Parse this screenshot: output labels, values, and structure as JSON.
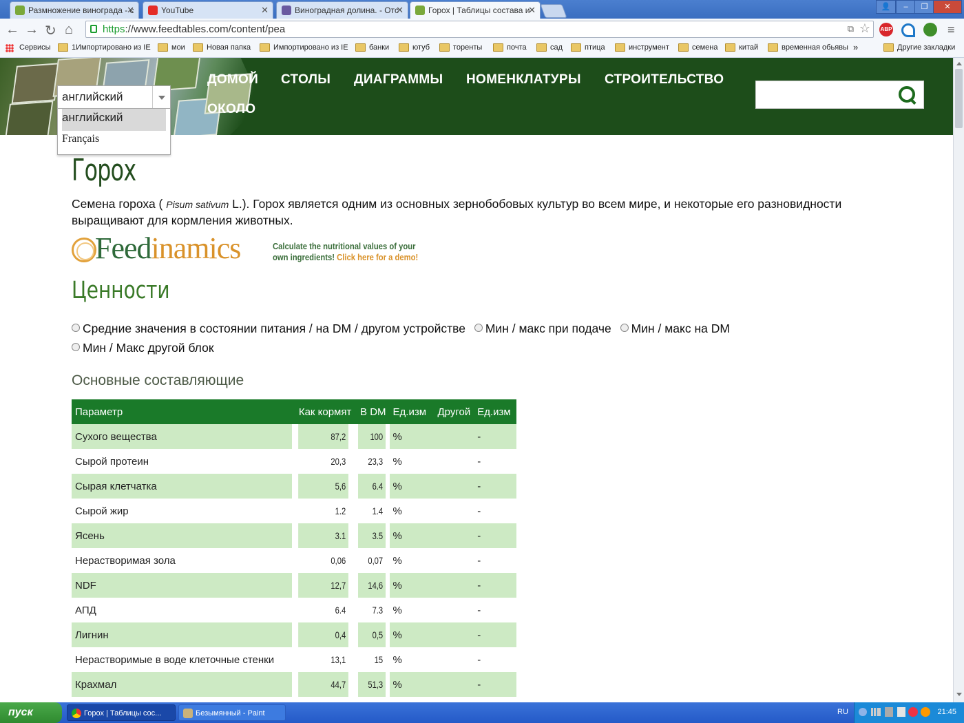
{
  "browser": {
    "tabs": [
      {
        "title": "Размножение винограда - с",
        "favicon_color": "#7aa83a",
        "active": false
      },
      {
        "title": "YouTube",
        "favicon_color": "#e52d27",
        "active": false
      },
      {
        "title": "Виноградная долина. - Отс",
        "favicon_color": "#6a5aa0",
        "active": false
      },
      {
        "title": "Горох | Таблицы состава и",
        "favicon_color": "#7aa83a",
        "active": true
      }
    ],
    "url_scheme": "https",
    "url_rest": "://www.feedtables.com/content/pea",
    "extensions": [
      "ABP"
    ],
    "bookmarks": [
      {
        "label": "Сервисы",
        "type": "apps"
      },
      {
        "label": "1Импортировано из IE",
        "type": "folder"
      },
      {
        "label": "мои",
        "type": "folder"
      },
      {
        "label": "Новая папка",
        "type": "folder"
      },
      {
        "label": "Импортировано из IE",
        "type": "folder"
      },
      {
        "label": "банки",
        "type": "folder"
      },
      {
        "label": "ютуб",
        "type": "folder"
      },
      {
        "label": "торенты",
        "type": "folder"
      },
      {
        "label": "почта",
        "type": "folder"
      },
      {
        "label": "сад",
        "type": "folder"
      },
      {
        "label": "птица",
        "type": "folder"
      },
      {
        "label": "инструмент",
        "type": "folder"
      },
      {
        "label": "семена",
        "type": "folder"
      },
      {
        "label": "китай",
        "type": "folder"
      },
      {
        "label": "временная обьявы",
        "type": "folder"
      }
    ],
    "more_bookmarks_glyph": "»",
    "other_bookmarks": "Другие закладки"
  },
  "site": {
    "nav": [
      "ДОМОЙ",
      "СТОЛЫ",
      "ДИАГРАММЫ",
      "НОМЕНКЛАТУРЫ",
      "СТРОИТЕЛЬСТВО",
      "ОКОЛО"
    ],
    "search_placeholder": "",
    "language": {
      "selected": "английский",
      "options": [
        "английский",
        "Français"
      ]
    }
  },
  "content": {
    "title": "Горох",
    "intro_before": "Семена гороха ( ",
    "intro_latin": "Pisum sativum",
    "intro_after": " L.). Горох является одним из основных зернобобовых культур во всем мире, и некоторые его разновидности выращивают для кормления животных.",
    "ad": {
      "logo_a": "Feed",
      "logo_b": "inamics",
      "line1": "Calculate the nutritional values of your",
      "line2_a": "own ingredients! ",
      "line2_b": "Click here for a demo!"
    },
    "values_heading": "Ценности",
    "radio_options": [
      "Средние значения в состоянии питания / на DM / другом устройстве",
      "Мин / макс при подаче",
      "Мин / макс на DM",
      "Мин / Макс другой блок"
    ],
    "table_heading": "Основные составляющие",
    "table": {
      "columns": [
        "Параметр",
        "Как кормят",
        "В DM",
        "Ед.изм",
        "Другой",
        "Ед.изм"
      ],
      "rows": [
        [
          "Сухого вещества",
          "87,2",
          "100",
          "%",
          "",
          "-"
        ],
        [
          "Сырой протеин",
          "20,3",
          "23,3",
          "%",
          "",
          "-"
        ],
        [
          "Сырая клетчатка",
          "5,6",
          "6.4",
          "%",
          "",
          "-"
        ],
        [
          "Сырой жир",
          "1.2",
          "1.4",
          "%",
          "",
          "-"
        ],
        [
          "Ясень",
          "3.1",
          "3.5",
          "%",
          "",
          "-"
        ],
        [
          "Нерастворимая зола",
          "0,06",
          "0,07",
          "%",
          "",
          "-"
        ],
        [
          "NDF",
          "12,7",
          "14,6",
          "%",
          "",
          "-"
        ],
        [
          "АПД",
          "6.4",
          "7.3",
          "%",
          "",
          "-"
        ],
        [
          "Лигнин",
          "0,4",
          "0,5",
          "%",
          "",
          "-"
        ],
        [
          "Нерастворимые в воде клеточные стенки",
          "13,1",
          "15",
          "%",
          "",
          "-"
        ],
        [
          "Крахмал",
          "44,7",
          "51,3",
          "%",
          "",
          "-"
        ]
      ]
    }
  },
  "taskbar": {
    "start": "пуск",
    "tasks": [
      "Горох | Таблицы сос...",
      "Безымянный - Paint"
    ],
    "lang": "RU",
    "time": "21:45"
  }
}
